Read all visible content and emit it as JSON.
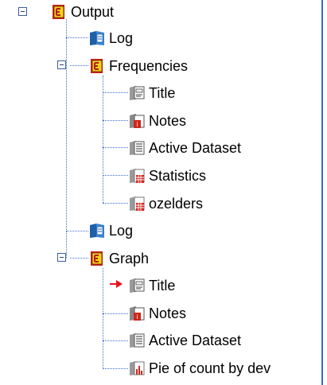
{
  "tree": {
    "root": {
      "label": "Output",
      "icon": "output-book-icon",
      "expanded": true
    },
    "items": [
      {
        "label": "Log",
        "icon": "log-book-icon",
        "level": 1
      },
      {
        "label": "Frequencies",
        "icon": "output-book-icon",
        "level": 1,
        "expanded": true,
        "children": [
          {
            "label": "Title",
            "icon": "title-icon"
          },
          {
            "label": "Notes",
            "icon": "notes-icon"
          },
          {
            "label": "Active Dataset",
            "icon": "dataset-icon"
          },
          {
            "label": "Statistics",
            "icon": "table-icon"
          },
          {
            "label": "ozelders",
            "icon": "table-icon"
          }
        ]
      },
      {
        "label": "Log",
        "icon": "log-book-icon",
        "level": 1
      },
      {
        "label": "Graph",
        "icon": "output-book-icon",
        "level": 1,
        "expanded": true,
        "children": [
          {
            "label": "Title",
            "icon": "title-icon",
            "current": true
          },
          {
            "label": "Notes",
            "icon": "notes-icon"
          },
          {
            "label": "Active Dataset",
            "icon": "dataset-icon"
          },
          {
            "label": "Pie of count by dev",
            "icon": "chart-icon"
          }
        ]
      }
    ]
  },
  "colors": {
    "connector": "#3b6fd1",
    "frame": "#2f6fc9",
    "current_arrow": "#e8121b",
    "book_red": "#c8201c",
    "book_yellow": "#f4d21a",
    "book_blue": "#1e5fa8"
  }
}
